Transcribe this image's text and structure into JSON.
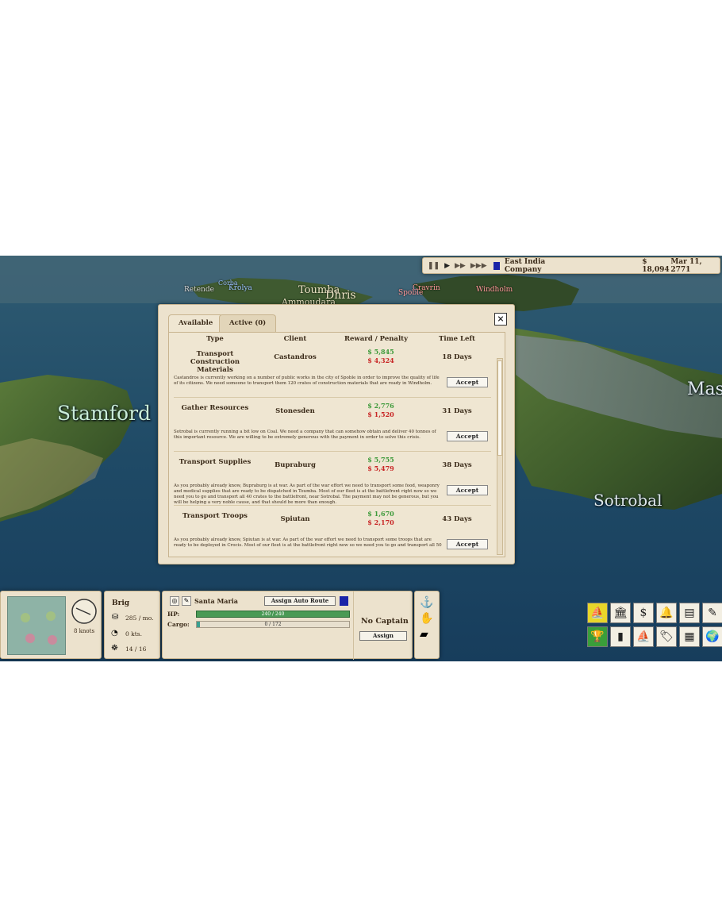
{
  "topbar": {
    "controls": [
      "❚❚",
      "▶",
      "▶▶",
      "▶▶▶"
    ],
    "company": "East India Company",
    "money": "$ 18,094",
    "date": "Mar 11, 2771"
  },
  "map": {
    "labels": {
      "stamford": "Stamford",
      "sotrobal": "Sotrobal",
      "mas": "Mas",
      "toumba": "Toumba",
      "dhris": "Dhris",
      "ammoudara": "Ammoudara",
      "retende": "Retende",
      "krolya": "Krolya",
      "corba": "Corba",
      "spoble": "Spoble",
      "cravrin": "Cravrin",
      "windholm": "Windholm"
    }
  },
  "dialog": {
    "tabs": {
      "available": "Available",
      "active": "Active (0)"
    },
    "close": "×",
    "headers": {
      "type": "Type",
      "client": "Client",
      "reward": "Reward / Penalty",
      "time": "Time Left"
    },
    "contracts": [
      {
        "type": "Transport Construction Materials",
        "client": "Castandros",
        "reward": "$ 5,845",
        "penalty": "$ 4,324",
        "time": "18 Days",
        "description": "Castandros is currently working on a number of public works in the city of Spoble in order to improve the quality of life of its citizens. We need someone to transport them 120 crates of construction materials that are ready in Windholm.",
        "button": "Accept"
      },
      {
        "type": "Gather Resources",
        "client": "Stonesden",
        "reward": "$ 2,776",
        "penalty": "$ 1,520",
        "time": "31 Days",
        "description": "Sotrobal is currently running a bit low on Coal. We need a company that can somehow obtain and deliver 40 tonnes of this important resource. We are willing to be extremely generous with the payment in order to solve this crisis.",
        "button": "Accept"
      },
      {
        "type": "Transport Supplies",
        "client": "Bupraburg",
        "reward": "$ 5,755",
        "penalty": "$ 5,479",
        "time": "38 Days",
        "description": "As you probably already know, Bupraburg is at war. As part of the war effort we need to transport some food, weaponry and medical supplies that are ready to be dispatched in Toumba. Most of our fleet is at the battlefront right now so we need you to go and transport all 40 crates to the battlefront, near Sotrobal. The payment may not be generous, but you will be helping a very noble cause, and that should be more than enough.",
        "button": "Accept"
      },
      {
        "type": "Transport Troops",
        "client": "Spiutan",
        "reward": "$ 1,670",
        "penalty": "$ 2,170",
        "time": "43 Days",
        "description": "As you probably already know, Spiutan is at war. As part of the war effort we need to transport some troops that are ready to be deployed in Crocis. Most of our fleet is at the battlefront right now so we need you to go and transport all 50",
        "button": "Accept"
      }
    ]
  },
  "ship": {
    "speed": "8 knots",
    "class": "Brig",
    "upkeep": "285 / mo.",
    "current_speed": "0 kts.",
    "crew": "14 / 16",
    "name": "Santa Maria",
    "auto_route": "Assign Auto Route",
    "hp_label": "HP:",
    "hp_value": "240 / 240",
    "hp_fraction": 1.0,
    "cargo_label": "Cargo:",
    "cargo_value": "0 / 172",
    "captain": "No Captain",
    "assign": "Assign",
    "flag_color": "#1a24a8"
  },
  "game_menu": {
    "icons": [
      "ship-money-icon",
      "bank-icon",
      "dollar-list-icon",
      "bell-icon",
      "newspaper-icon",
      "notes-icon",
      "trophy-icon",
      "stats-icon",
      "sail-icon",
      "tags-icon",
      "buildings-icon",
      "globe-icon"
    ]
  }
}
